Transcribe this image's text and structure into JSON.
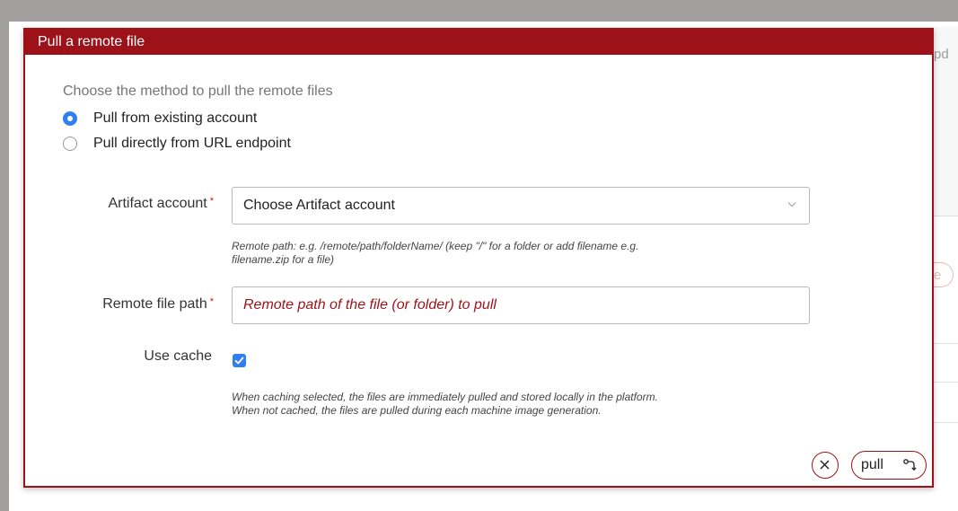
{
  "background": {
    "partial_text": "pd"
  },
  "modal": {
    "title": "Pull a remote file",
    "method_title": "Choose the method to pull the remote files",
    "methods": [
      {
        "label": "Pull from existing account",
        "selected": true
      },
      {
        "label": "Pull directly from URL endpoint",
        "selected": false
      }
    ],
    "artifact_account": {
      "label": "Artifact account",
      "required_mark": "*",
      "value": "Choose Artifact account",
      "icon": "chevron-down-icon"
    },
    "remote_path_hint": {
      "line1": "Remote path: e.g. /remote/path/folderName/ (keep \"/\" for a folder or add filename e.g.",
      "line2": "filename.zip for a file)"
    },
    "remote_file_path": {
      "label": "Remote file path",
      "required_mark": "*",
      "placeholder": "Remote path of the file (or folder) to pull"
    },
    "use_cache": {
      "label": "Use cache",
      "checked": true
    },
    "cache_hint": {
      "line1": "When caching selected, the files are immediately pulled and stored locally in the platform.",
      "line2": "When not cached, the files are pulled during each machine image generation."
    },
    "actions": {
      "cancel_icon": "close-icon",
      "pull_label": "pull",
      "pull_icon": "pull-icon"
    }
  },
  "colors": {
    "brand": "#9d1219",
    "accent": "#2f7ff3"
  }
}
